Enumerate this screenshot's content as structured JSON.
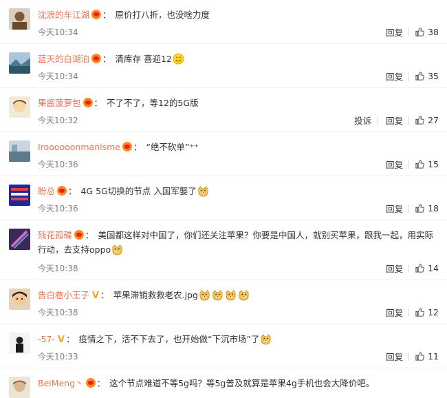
{
  "comments": [
    {
      "username": "沈浪的车江湖",
      "badge": "heart",
      "colon": "：",
      "text": "原价打八折，也没啥力度",
      "emojis": [],
      "time": "今天10:34",
      "report_label": "",
      "reply_label": "回复",
      "likes": "38",
      "avatar_color": "#8a6a4a"
    },
    {
      "username": "蓝天的白湖泊",
      "badge": "heart",
      "colon": "：",
      "text": "清库存 喜迎12",
      "emojis": [
        "smile-emoji"
      ],
      "time": "今天10:34",
      "report_label": "",
      "reply_label": "回复",
      "likes": "35",
      "avatar_color": "#3b6f8f"
    },
    {
      "username": "果酱菠萝包",
      "badge": "heart",
      "colon": "：",
      "text": "不了不了，等12的5G版",
      "emojis": [],
      "time": "今天10:32",
      "report_label": "投诉",
      "reply_label": "回复",
      "likes": "27",
      "avatar_color": "#c9b48a"
    },
    {
      "username": "Iroooooonmanlsme",
      "badge": "heart",
      "colon": "：",
      "text": "“绝不砍单”⁺⁺",
      "emojis": [],
      "time": "今天10:36",
      "report_label": "",
      "reply_label": "回复",
      "likes": "15",
      "avatar_color": "#6f8fa6"
    },
    {
      "username": "盼总",
      "badge": "heart",
      "colon": "：",
      "text": "4G 5G切换的节点 入国军娶了",
      "emojis": [
        "doge-emoji"
      ],
      "time": "今天10:36",
      "report_label": "",
      "reply_label": "回复",
      "likes": "18",
      "avatar_color": "#2a3aa8"
    },
    {
      "username": "残花孤碟",
      "badge": "heart",
      "colon": "：",
      "text": "美国都这样对中国了，你们还关注苹果？你要是中国人，就别买苹果，跟我一起，用实际行动，去支持oppo",
      "emojis": [
        "doge-emoji"
      ],
      "time": "今天10:38",
      "report_label": "",
      "reply_label": "回复",
      "likes": "14",
      "avatar_color": "#5a3a7a"
    },
    {
      "username": "告白巷小王子",
      "badge": "v",
      "colon": "：",
      "text": "苹果滞销救救老农.jpg",
      "emojis": [
        "doge-emoji",
        "doge-emoji",
        "doge-emoji",
        "doge-emoji"
      ],
      "time": "今天10:38",
      "report_label": "",
      "reply_label": "回复",
      "likes": "12",
      "avatar_color": "#5a4030"
    },
    {
      "username": "-57-",
      "badge": "v",
      "colon": "：",
      "text": "疫情之下，活不下去了，也开始做“下沉市场”了",
      "emojis": [
        "doge-emoji"
      ],
      "time": "今天10:33",
      "report_label": "",
      "reply_label": "回复",
      "likes": "11",
      "avatar_color": "#2a2a2a"
    },
    {
      "username": "BeiMeng丶",
      "badge": "heart",
      "colon": "：",
      "text": "这个节点难道不等5g吗？等5g普及就算是苹果4g手机也会大降价吧。",
      "emojis": [],
      "time": "",
      "report_label": "",
      "reply_label": "",
      "likes": "",
      "avatar_color": "#b8a890"
    }
  ]
}
